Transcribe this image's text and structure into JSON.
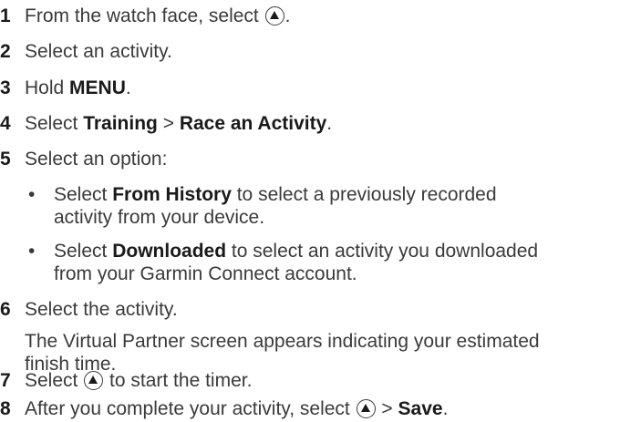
{
  "steps": [
    {
      "num": "1",
      "pre": "From the watch face, select ",
      "icon": "up-button-icon",
      "post": "."
    },
    {
      "num": "2",
      "text": "Select an activity."
    },
    {
      "num": "3",
      "pre": "Hold ",
      "bold": "MENU",
      "post": "."
    },
    {
      "num": "4",
      "pre": "Select ",
      "bold1": "Training",
      "mid": " > ",
      "bold2": "Race an Activity",
      "post": "."
    },
    {
      "num": "5",
      "text": "Select an option:"
    },
    {
      "num": "6",
      "text": "Select the activity."
    },
    {
      "num": "7",
      "pre": "Select ",
      "icon": "up-button-icon",
      "post": " to start the timer."
    },
    {
      "num": "8",
      "pre": "After you complete your activity, select ",
      "icon": "up-button-icon",
      "mid": " > ",
      "bold": "Save",
      "post": "."
    }
  ],
  "options": [
    {
      "bullet": "•",
      "pre": "Select ",
      "bold": "From History",
      "line1_post": " to select a previously recorded",
      "line2": "activity from your device."
    },
    {
      "bullet": "•",
      "pre": "Select ",
      "bold": "Downloaded",
      "line1_post": " to select an activity you downloaded",
      "line2": "from your Garmin Connect account."
    }
  ],
  "step6_note": {
    "line1": "The Virtual Partner screen appears indicating your estimated",
    "line2": "finish time."
  }
}
